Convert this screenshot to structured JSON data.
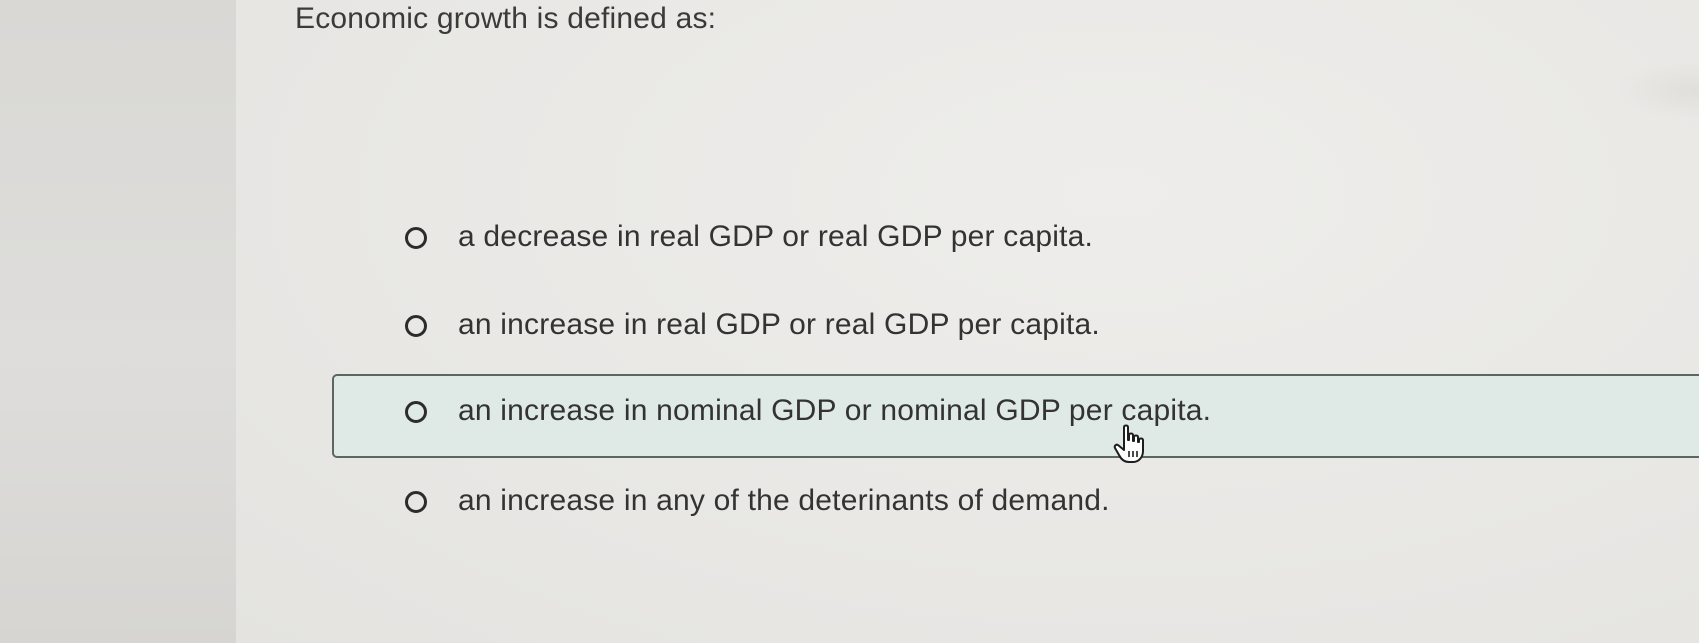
{
  "question": {
    "text": "Economic growth is defined as:"
  },
  "options": [
    {
      "label": "a decrease in real GDP or real GDP per capita.",
      "selected": false
    },
    {
      "label": "an increase in real GDP or real GDP per capita.",
      "selected": false
    },
    {
      "label": "an increase in nominal GDP or nominal GDP per capita.",
      "selected": false,
      "hovered": true
    },
    {
      "label": "an increase in any of the deterinants of demand.",
      "selected": false
    }
  ],
  "colors": {
    "hover_background": "#dfe9e6",
    "hover_border": "#5e6663",
    "text": "#333333",
    "page_background": "#eae9e6"
  },
  "icons": {
    "radio": "radio-unchecked-icon",
    "cursor": "pointer-hand-cursor-icon"
  }
}
